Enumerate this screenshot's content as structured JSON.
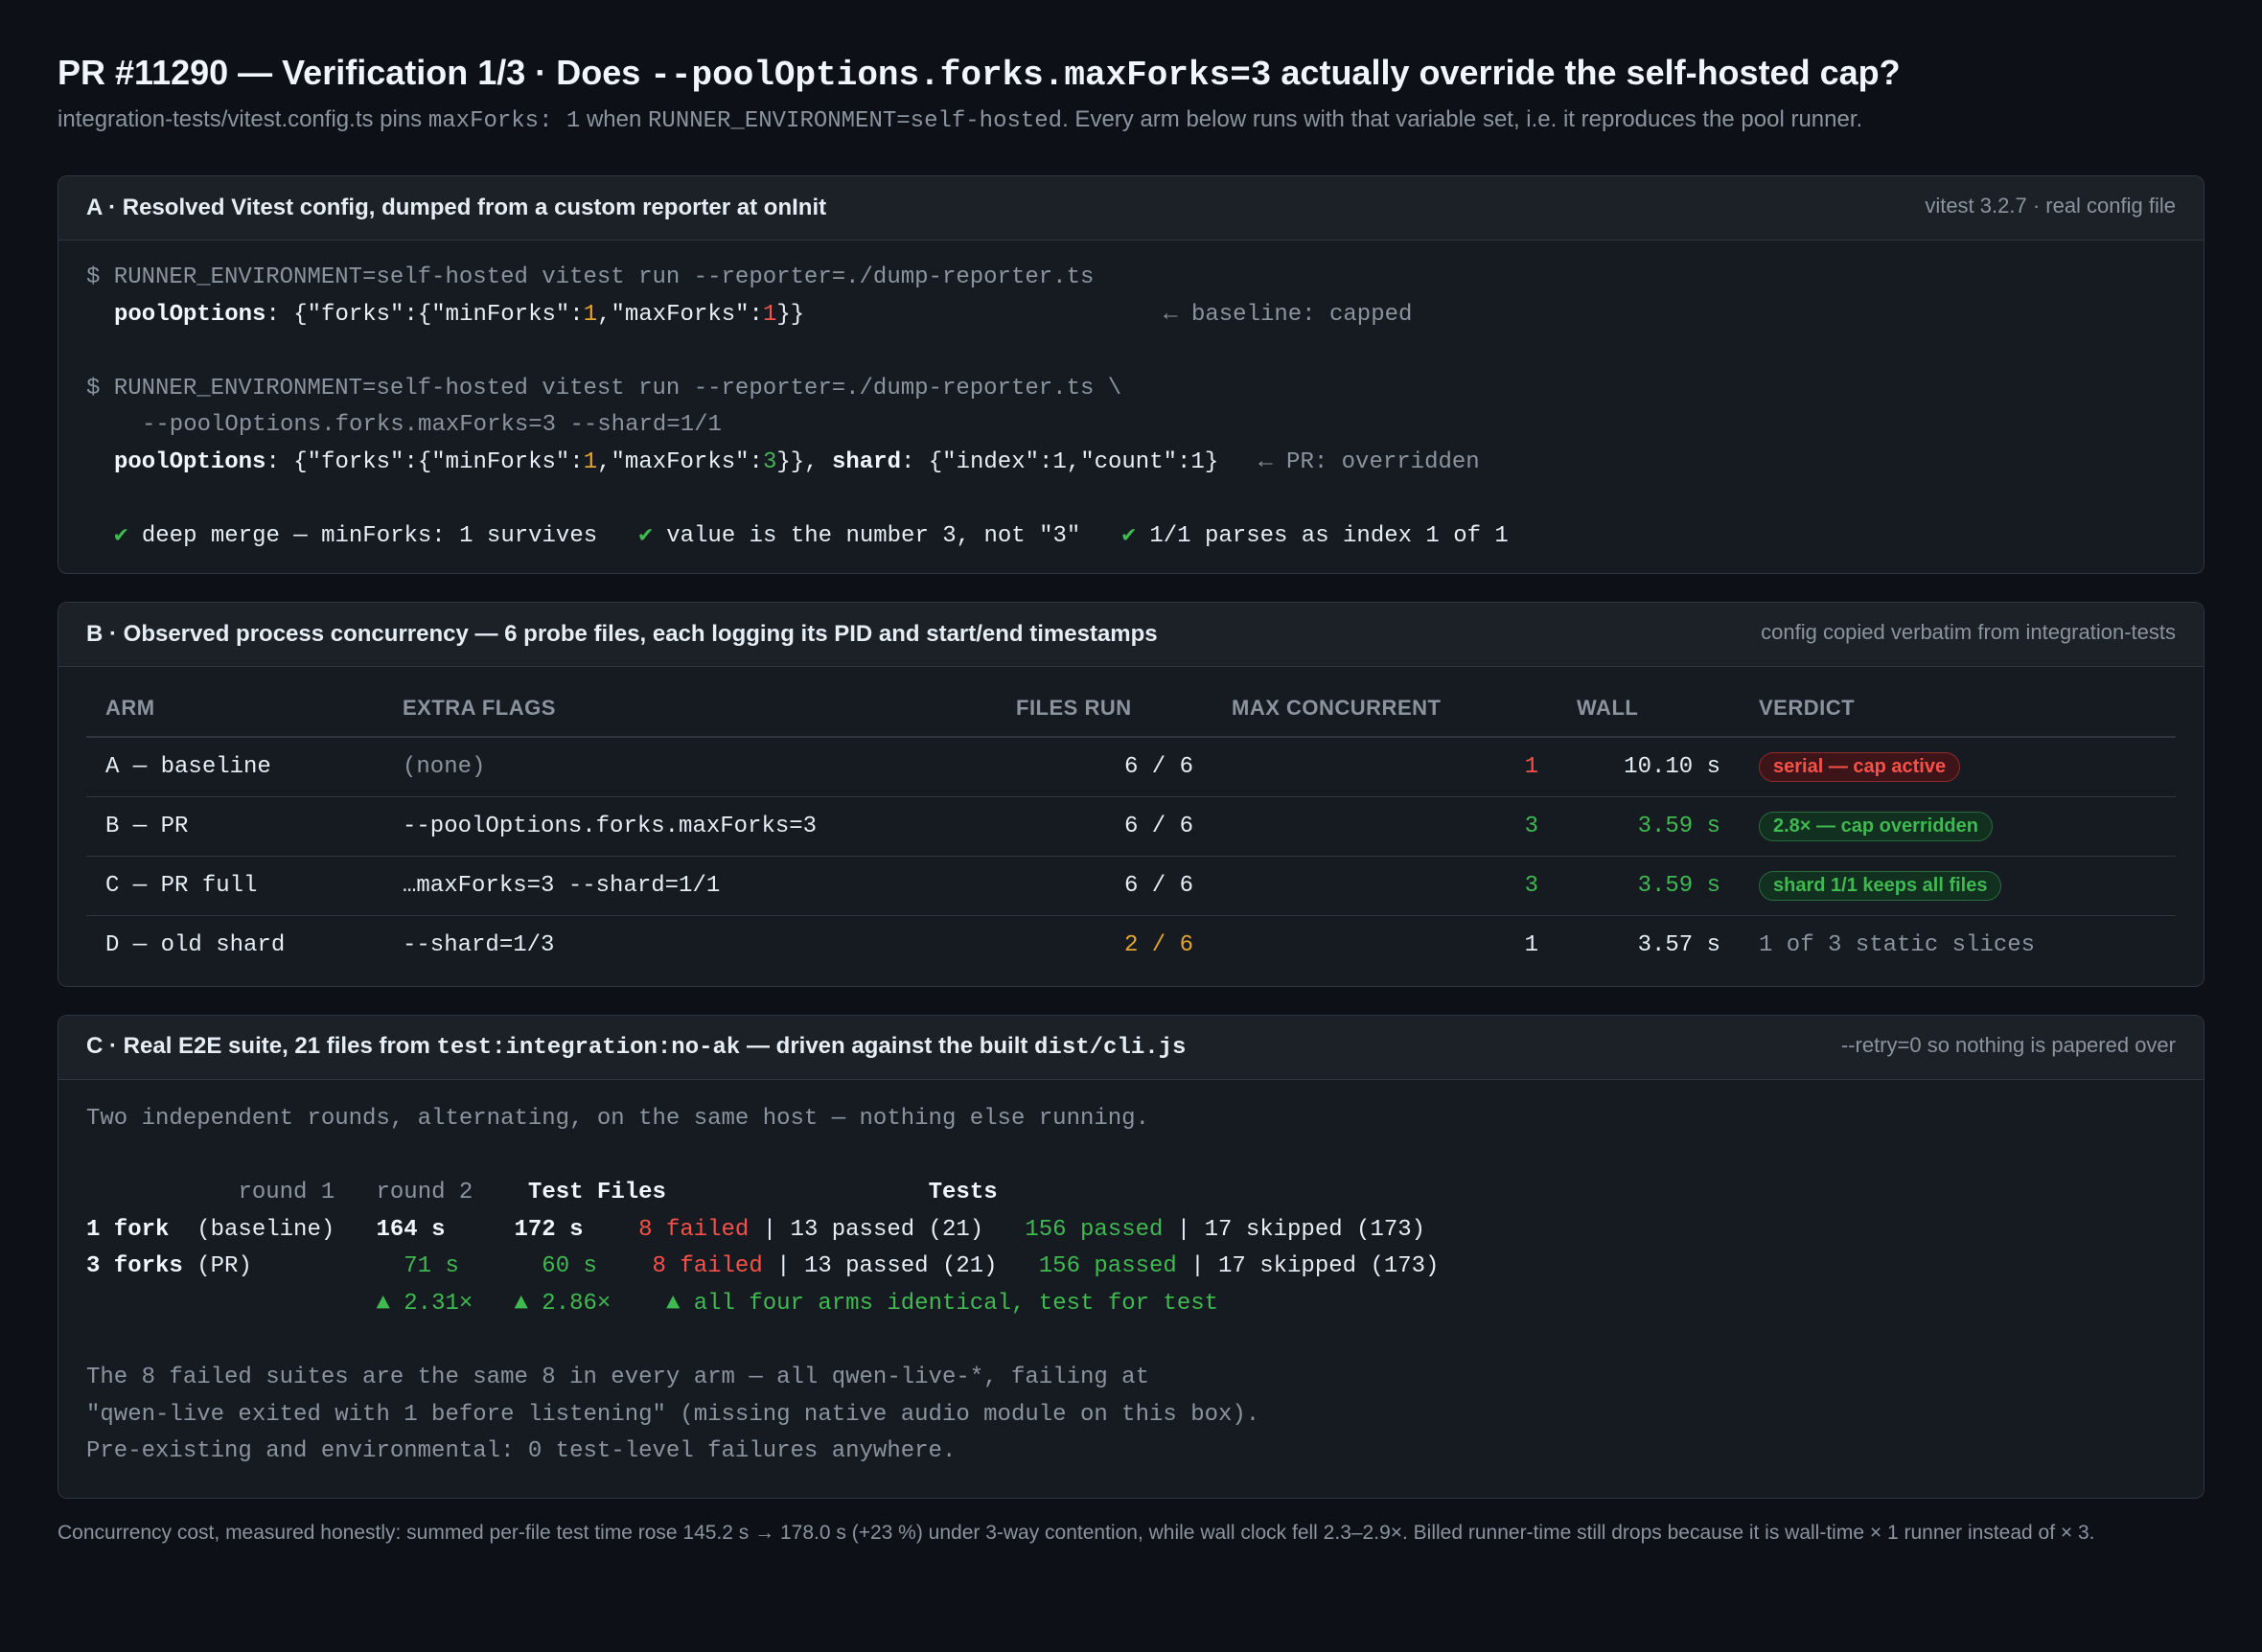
{
  "header": {
    "title_pre": "PR #11290 — Verification 1/3 · Does ",
    "title_code": "--poolOptions.forks.maxForks=3",
    "title_post": " actually override the self-hosted cap?",
    "sub_1": "integration-tests/vitest.config.ts pins ",
    "sub_code_1": "maxForks: 1",
    "sub_2": " when ",
    "sub_code_2": "RUNNER_ENVIRONMENT=self-hosted",
    "sub_3": ". Every arm below runs with that variable set, i.e. it reproduces the pool runner."
  },
  "panel_a": {
    "title": "A · Resolved Vitest config, dumped from a custom reporter at onInit",
    "note": "vitest 3.2.7 · real config file",
    "cmd1": "$ RUNNER_ENVIRONMENT=self-hosted vitest run --reporter=./dump-reporter.ts",
    "out1_key": "poolOptions",
    "out1_a": ": {\"forks\":{\"minForks\":",
    "out1_min": "1",
    "out1_b": ",\"maxForks\":",
    "out1_max": "1",
    "out1_c": "}}",
    "out1_note": "← baseline: capped",
    "cmd2_line1": "$ RUNNER_ENVIRONMENT=self-hosted vitest run --reporter=./dump-reporter.ts \\",
    "cmd2_line2": "--poolOptions.forks.maxForks=3 --shard=1/1",
    "out2_key": "poolOptions",
    "out2_a": ": {\"forks\":{\"minForks\":",
    "out2_min": "1",
    "out2_b": ",\"maxForks\":",
    "out2_max": "3",
    "out2_c": "}}, ",
    "out2_key2": "shard",
    "out2_d": ": {\"index\":1,\"count\":1}",
    "out2_note": "← PR: overridden",
    "checks": [
      "deep merge — minForks: 1 survives",
      "value is the number 3, not \"3\"",
      "1/1 parses as index 1 of 1"
    ],
    "check_glyph": "✔"
  },
  "panel_b": {
    "title": "B · Observed process concurrency — 6 probe files, each logging its PID and start/end timestamps",
    "note": "config copied verbatim from integration-tests",
    "columns": [
      "ARM",
      "EXTRA FLAGS",
      "FILES RUN",
      "MAX CONCURRENT",
      "WALL",
      "VERDICT"
    ],
    "rows": [
      {
        "arm": "A — baseline",
        "flags": "(none)",
        "files": "6 / 6",
        "conc": "1",
        "wall": "10.10 s",
        "verdict": "serial — cap active"
      },
      {
        "arm": "B — PR",
        "flags": "--poolOptions.forks.maxForks=3",
        "files": "6 / 6",
        "conc": "3",
        "wall": "3.59 s",
        "verdict": "2.8× — cap overridden"
      },
      {
        "arm": "C — PR full",
        "flags": "…maxForks=3 --shard=1/1",
        "files": "6 / 6",
        "conc": "3",
        "wall": "3.59 s",
        "verdict": "shard 1/1 keeps all files"
      },
      {
        "arm": "D — old shard",
        "flags": "--shard=1/3",
        "files": "2 / 6",
        "conc": "1",
        "wall": "3.57 s",
        "verdict": "1 of 3 static slices"
      }
    ]
  },
  "panel_c": {
    "title_1": "C · Real E2E suite, 21 files from ",
    "title_code_1": "test:integration:no-ak",
    "title_2": " — driven against the built ",
    "title_code_2": "dist/cli.js",
    "note": "--retry=0 so nothing is papered over",
    "intro": "Two independent rounds, alternating, on the same host — nothing else running.",
    "hdr_pad": "           ",
    "hdr_round1": "round 1",
    "hdr_gap": "   ",
    "hdr_round2": "round 2",
    "hdr_gap2": "    ",
    "hdr_files": "Test Files",
    "hdr_gap3": "                   ",
    "hdr_tests": "Tests",
    "row1_label": "1 fork",
    "row1_paren": "  (baseline)",
    "row1_r1": "   164 s",
    "row1_r2": "     172 s",
    "row2_label": "3 forks",
    "row2_paren": " (PR)       ",
    "row2_r1": "    71 s",
    "row2_r2": "      60 s",
    "failed": "8 failed",
    "passed_files": " | 13 passed (21)   ",
    "passed_tests": "156 passed",
    "skipped": " | 17 skipped (173)",
    "gain_pad": "                     ",
    "gain_1": "▲ 2.31×",
    "gain_2": "▲ 2.86×",
    "gain_3": "▲ all four arms identical, test for test",
    "note_1": "The 8 failed suites are the same 8 in every arm — all qwen-live-*, failing at",
    "note_2": "\"qwen-live exited with 1 before listening\" (missing native audio module on this box).",
    "note_3": "Pre-existing and environmental: 0 test-level failures anywhere."
  },
  "footer": "Concurrency cost, measured honestly: summed per-file test time rose 145.2 s → 178.0 s (+23 %) under 3-way contention, while wall clock fell 2.3–2.9×. Billed runner-time still drops because it is wall-time × 1 runner instead of × 3."
}
